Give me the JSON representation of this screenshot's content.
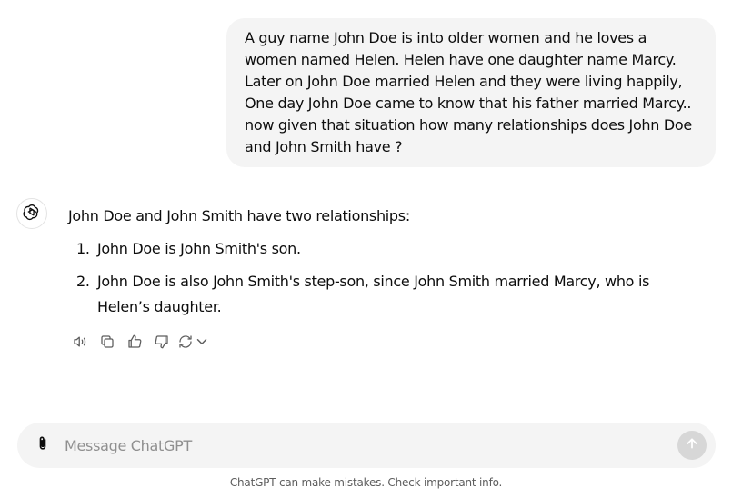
{
  "conversation": {
    "user_message": "A guy name John Doe is into older women and he loves a women named Helen. Helen have one daughter name Marcy. Later on John Doe married Helen and they were living happily, One day John Doe came to know that his father married Marcy.. now given that situation how many relationships does John Doe and John Smith have ?",
    "assistant": {
      "intro": "John Doe and John Smith have two relationships:",
      "items": [
        {
          "num": "1.",
          "text": "John Doe is John Smith's son."
        },
        {
          "num": "2.",
          "text": "John Doe is also John Smith's step-son, since John Smith married Marcy, who is Helen’s daughter."
        }
      ],
      "avatar_icon": "openai-logo-icon"
    },
    "actions": [
      "read-aloud-icon",
      "copy-icon",
      "thumbs-up-icon",
      "thumbs-down-icon",
      "regenerate-icon"
    ]
  },
  "composer": {
    "placeholder": "Message ChatGPT",
    "value": ""
  },
  "disclaimer": "ChatGPT can make mistakes. Check important info.",
  "colors": {
    "bubble_bg": "#f4f4f4",
    "composer_bg": "#f4f4f4",
    "send_disabled": "#d7d7d7",
    "muted_text": "#5d5d5d"
  }
}
